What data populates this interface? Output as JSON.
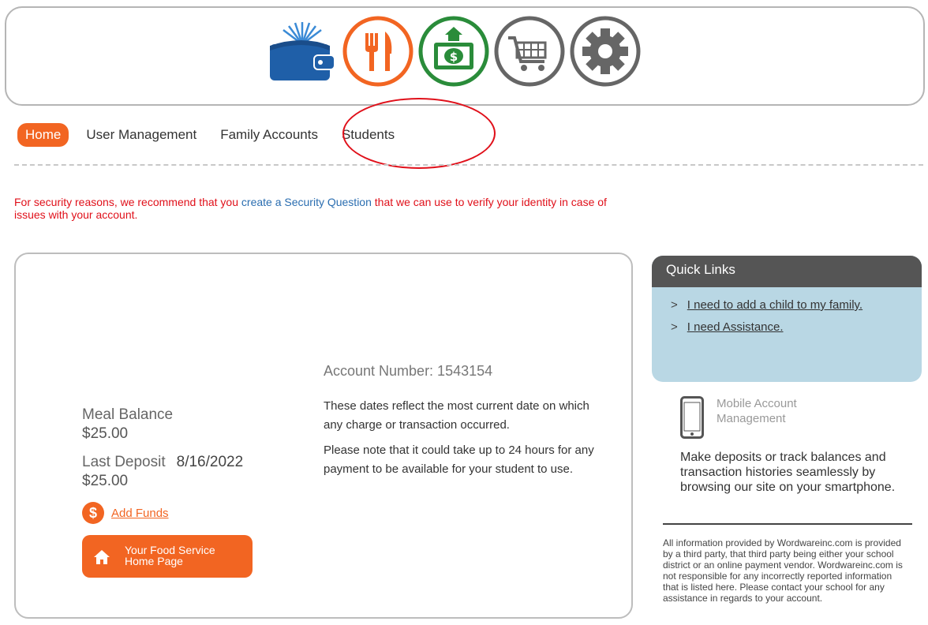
{
  "icons": [
    {
      "name": "wallet-book-icon",
      "color": "#1f5fa8"
    },
    {
      "name": "fork-knife-icon",
      "color": "#f26522"
    },
    {
      "name": "money-bill-icon",
      "color": "#2a8c3a"
    },
    {
      "name": "shopping-cart-icon",
      "color": "#666666"
    },
    {
      "name": "gear-icon",
      "color": "#666666"
    }
  ],
  "nav": {
    "home": "Home",
    "user_management": "User Management",
    "family_accounts": "Family Accounts",
    "students": "Students"
  },
  "notice": {
    "before": "For security reasons, we recommend that you ",
    "link": "create a Security Question",
    "after": " that we can use to verify your identity in case of issues with your account."
  },
  "account": {
    "meal_balance_label": "Meal Balance",
    "meal_balance": "$25.00",
    "last_deposit_label": "Last Deposit",
    "last_deposit_date": "8/16/2022",
    "last_deposit_amount": "$25.00",
    "add_funds": "Add Funds",
    "food_service_line1": "Your Food Service",
    "food_service_line2": "Home Page",
    "account_number": "Account Number: 1543154",
    "para1": "These dates reflect the most current date on which any charge or transaction occurred.",
    "para2": "Please note that it could take up to 24 hours for any payment to be available for your student to use."
  },
  "quick_links": {
    "title": "Quick Links",
    "chevron": ">",
    "items": [
      "I need to add a child to my family.",
      "I need Assistance."
    ]
  },
  "mobile": {
    "title": "Mobile Account Management",
    "description": "Make deposits or track balances and transaction histories seamlessly by browsing our site on your smartphone."
  },
  "disclaimer": "All information provided by Wordwareinc.com is provided by a third party, that third party being either your school district or an online payment vendor. Wordwareinc.com is not responsible for any incorrectly reported information that is listed here. Please contact your school for any assistance in regards to your account."
}
